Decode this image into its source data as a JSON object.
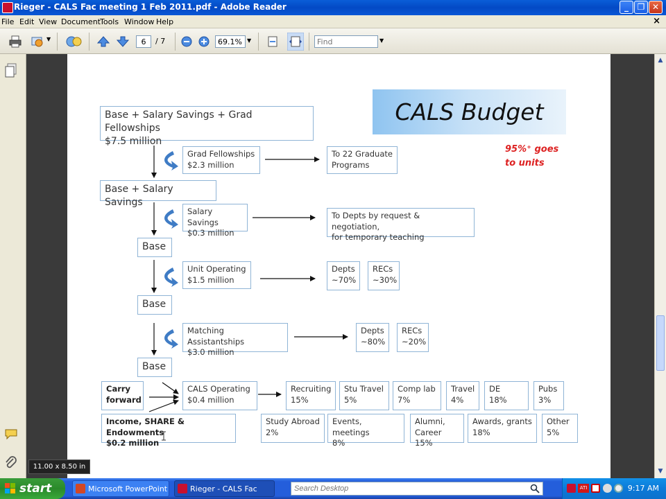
{
  "window": {
    "title": "Rieger - CALS Fac meeting 1 Feb 2011.pdf - Adobe Reader",
    "menu_close": "×"
  },
  "menu": [
    "File",
    "Edit",
    "View",
    "Document",
    "Tools",
    "Window",
    "Help"
  ],
  "toolbar": {
    "page_current": "6",
    "page_total": "/ 7",
    "zoom": "69.1%",
    "find_placeholder": "Find"
  },
  "slide": {
    "title": "CALS Budget",
    "note_line1": "95%⁺ goes",
    "note_line2": "to units",
    "top_box_line1": "Base + Salary Savings + Grad Fellowships",
    "top_box_line2": "$7.5 million",
    "grad_fellowships_line1": "Grad Fellowships",
    "grad_fellowships_line2": "$2.3 million",
    "grad_programs_line1": "To 22 Graduate",
    "grad_programs_line2": "Programs",
    "base_salary_savings": "Base + Salary Savings",
    "salary_savings_line1": "Salary Savings",
    "salary_savings_line2": "$0.3 million",
    "depts_request_line1": "To Depts by request & negotiation,",
    "depts_request_line2": "for temporary teaching",
    "base_1": "Base",
    "unit_operating_line1": "Unit Operating",
    "unit_operating_line2": "$1.5 million",
    "unit_depts_line1": "Depts",
    "unit_depts_line2": "~70%",
    "unit_recs_line1": "RECs",
    "unit_recs_line2": "~30%",
    "base_2": "Base",
    "matching_line1": "Matching Assistantships",
    "matching_line2": "$3.0 million",
    "match_depts_line1": "Depts",
    "match_depts_line2": "~80%",
    "match_recs_line1": "RECs",
    "match_recs_line2": "~20%",
    "base_3": "Base",
    "carry_line1": "Carry",
    "carry_line2": "forward",
    "cals_op_line1": "CALS Operating",
    "cals_op_line2": "$0.4 million",
    "income_line1": "Income, SHARE & Endowments",
    "income_line2": "$0.2 million",
    "allocations_row1": [
      {
        "line1": "Recruiting",
        "line2": "15%"
      },
      {
        "line1": "Stu Travel",
        "line2": "5%"
      },
      {
        "line1": "Comp lab",
        "line2": "7%"
      },
      {
        "line1": "Travel",
        "line2": "4%"
      },
      {
        "line1": "DE",
        "line2": "18%"
      },
      {
        "line1": "Pubs",
        "line2": "3%"
      }
    ],
    "allocations_row2": [
      {
        "line1": "Study Abroad",
        "line2": "2%"
      },
      {
        "line1": "Events, meetings",
        "line2": "8%"
      },
      {
        "line1": "Alumni,",
        "line2": "Career 15%"
      },
      {
        "line1": "Awards, grants",
        "line2": "18%"
      },
      {
        "line1": "Other",
        "line2": "5%"
      }
    ]
  },
  "status": {
    "page_size": "11.00 x 8.50 in"
  },
  "taskbar": {
    "start": "start",
    "task1": "Microsoft PowerPoint ...",
    "task2": "Rieger - CALS Fac me...",
    "search_placeholder": "Search Desktop",
    "clock": "9:17 AM"
  }
}
